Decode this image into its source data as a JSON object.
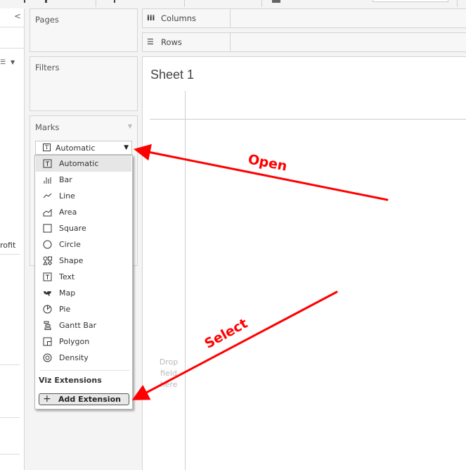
{
  "data_pane": {
    "collapse_glyph": "<",
    "field_label": "rofit"
  },
  "shelves": {
    "pages": "Pages",
    "filters": "Filters",
    "marks": "Marks",
    "columns": "Columns",
    "rows": "Rows"
  },
  "marks_card": {
    "selected_type": "Automatic",
    "dropdown_items": [
      {
        "label": "Automatic",
        "icon": "text-box-icon",
        "selected": true
      },
      {
        "label": "Bar",
        "icon": "bar-icon"
      },
      {
        "label": "Line",
        "icon": "line-icon"
      },
      {
        "label": "Area",
        "icon": "area-icon"
      },
      {
        "label": "Square",
        "icon": "square-icon"
      },
      {
        "label": "Circle",
        "icon": "circle-icon"
      },
      {
        "label": "Shape",
        "icon": "shape-icon"
      },
      {
        "label": "Text",
        "icon": "text-box-icon"
      },
      {
        "label": "Map",
        "icon": "map-icon"
      },
      {
        "label": "Pie",
        "icon": "pie-icon"
      },
      {
        "label": "Gantt Bar",
        "icon": "gantt-bar-icon"
      },
      {
        "label": "Polygon",
        "icon": "polygon-icon"
      },
      {
        "label": "Density",
        "icon": "density-icon"
      }
    ],
    "section_title": "Viz Extensions",
    "add_extension": "Add Extension"
  },
  "canvas": {
    "sheet_title": "Sheet 1",
    "drop_hint": "Drop field here"
  },
  "annotations": {
    "open": "Open",
    "select": "Select",
    "color": "#ff0000"
  }
}
